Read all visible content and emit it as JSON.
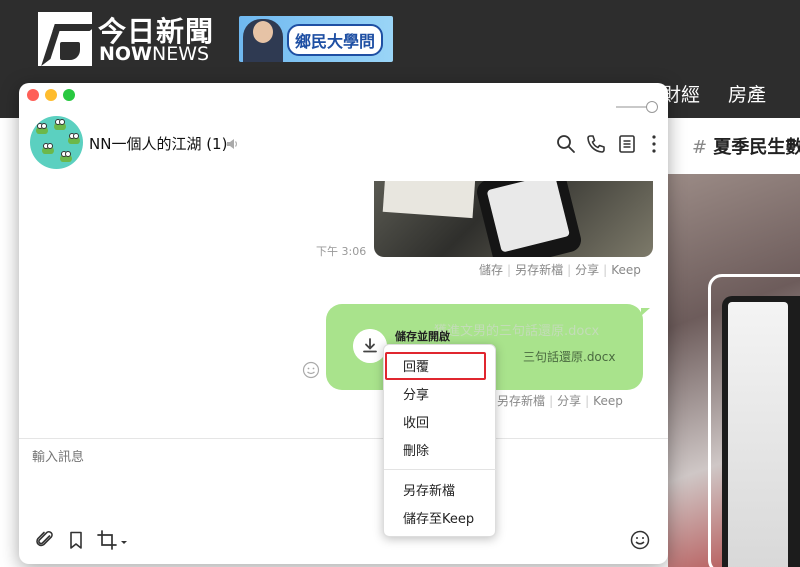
{
  "site": {
    "logo_title": "今日新聞",
    "logo_sub_bold": "NOW",
    "logo_sub_light": "NEWS",
    "ad_text": "鄉民大學問",
    "nav": {
      "finance": "財經",
      "realestate": "房產"
    },
    "hashtag": "夏季民生數"
  },
  "chat": {
    "name": "NN一個人的江湖 (1)",
    "time_left": "下午 3:06",
    "photo_actions": [
      "儲存",
      "另存新檔",
      "分享",
      "Keep"
    ],
    "file": {
      "label": "儲存並開啟",
      "name_bg": "獲進文男的三句話還原.docx",
      "name": "三句話還原.docx"
    },
    "file_actions": [
      "另存新檔",
      "分享",
      "Keep"
    ],
    "compose_placeholder": "輸入訊息"
  },
  "context_menu": {
    "items": [
      "回覆",
      "分享",
      "收回",
      "刪除"
    ],
    "items2": [
      "另存新檔",
      "儲存至Keep"
    ]
  },
  "colors": {
    "bubble_green": "#a9e38c",
    "highlight_red": "#e0262f",
    "avatar_teal": "#5bd0c0"
  },
  "icons": [
    "speaker-icon",
    "search-icon",
    "phone-icon",
    "note-icon",
    "more-icon",
    "download-icon",
    "emoji-icon",
    "attach-icon",
    "bookmark-icon",
    "crop-icon",
    "sticker-icon"
  ]
}
